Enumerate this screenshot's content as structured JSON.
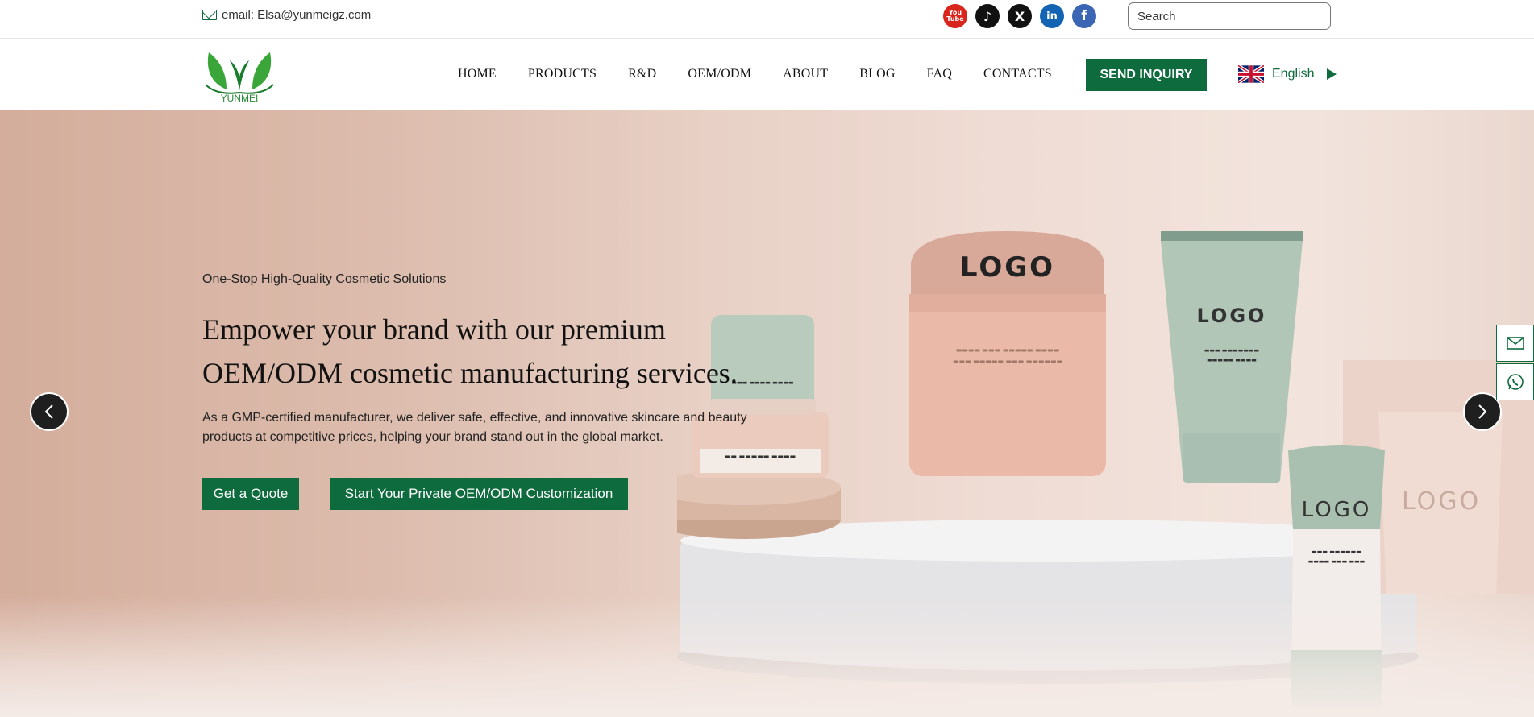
{
  "topbar": {
    "email": "email: Elsa@yunmeigz.com",
    "socials": [
      "youtube-icon",
      "tiktok-icon",
      "x-icon",
      "linkedin-icon",
      "facebook-icon"
    ],
    "youtube_text": "You Tube",
    "search_placeholder": "Search"
  },
  "header": {
    "logo_text": "YUNMEI",
    "nav": [
      "HOME",
      "PRODUCTS",
      "R&D",
      "OEM/ODM",
      "ABOUT",
      "BLOG",
      "FAQ",
      "CONTACTS"
    ],
    "inquiry_label": "SEND INQUIRY",
    "language": "English"
  },
  "hero": {
    "subtitle": "One-Stop High-Quality Cosmetic Solutions",
    "title": "Empower your brand with our premium OEM/ODM cosmetic manufacturing services.",
    "description": "As a GMP-certified manufacturer, we deliver safe, effective, and innovative skincare and beauty products at competitive prices, helping your brand stand out in the global market.",
    "quote_button": "Get a Quote",
    "oem_button": "Start Your Private OEM/ODM Customization",
    "product_logo_text": "LOGO"
  },
  "colors": {
    "brand_green": "#0e6b3d",
    "hero_bg": "#e7cfc4"
  }
}
